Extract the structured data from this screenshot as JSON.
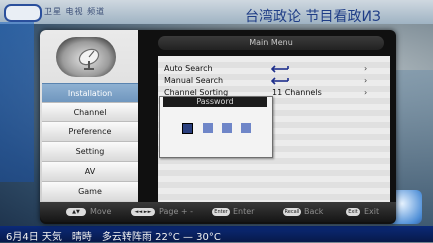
{
  "broadcast": {
    "top_ticker": "台湾政论 节目看政ИЗ",
    "bottom_ticker": "6月4日 天気　晴時　多云转阵雨 22°C — 30°C",
    "logo_text": "卫星 电视 频道"
  },
  "menu": {
    "title": "Main Menu",
    "nav_items": [
      {
        "label": "Installation",
        "active": true
      },
      {
        "label": "Channel",
        "active": false
      },
      {
        "label": "Preference",
        "active": false
      },
      {
        "label": "Setting",
        "active": false
      },
      {
        "label": "AV",
        "active": false
      },
      {
        "label": "Game",
        "active": false
      }
    ],
    "rows": [
      {
        "label": "Auto Search",
        "icon": "enter-arrow-icon",
        "value": "",
        "arrow": "›"
      },
      {
        "label": "Manual Search",
        "icon": "enter-arrow-icon",
        "value": "",
        "arrow": "›"
      },
      {
        "label": "Channel Sorting",
        "icon": "",
        "value": "11 Channels",
        "arrow": "›"
      }
    ]
  },
  "password_dialog": {
    "title": "Password",
    "digits_total": 4,
    "current_index": 0
  },
  "footer": {
    "hints": [
      {
        "key": "▲▼",
        "label": "Move"
      },
      {
        "key": "◄◄ ►►",
        "label": "Page + -"
      },
      {
        "key": "Enter",
        "label": "Enter"
      },
      {
        "key": "Recall",
        "label": "Back"
      },
      {
        "key": "Exit",
        "label": "Exit"
      }
    ]
  },
  "colors": {
    "nav_active": "#7aa1c8",
    "password_box": "#6f86c8",
    "password_box_current": "#2a3f7e"
  }
}
